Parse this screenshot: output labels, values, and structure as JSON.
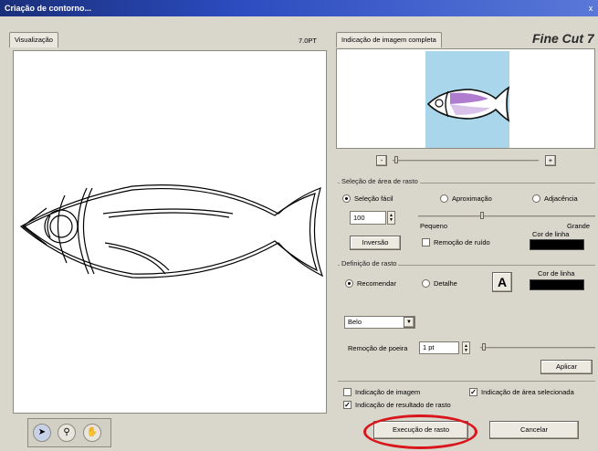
{
  "window": {
    "title": "Criação de contorno...",
    "close_glyph": "x"
  },
  "left_panel": {
    "tab_label": "Visualização",
    "thickness": "7.0PT"
  },
  "right_panel": {
    "tab_label": "Indicação de imagem completa",
    "logo": "Fine Cut 7",
    "zoom_minus": "-",
    "zoom_plus": "+"
  },
  "selection_group": {
    "title": "Seleção de área de rasto",
    "options": [
      "Seleção fácil",
      "Aproximação",
      "Adjacência"
    ],
    "selected_option": "Seleção fácil",
    "value": "100",
    "slider_min_label": "Pequeno",
    "slider_max_label": "Grande",
    "line_color_label": "Cor de linha",
    "line_color": "#000000",
    "inversion_button": "Inversão",
    "noise_removal_label": "Remoção de ruído",
    "noise_removal_checked": false
  },
  "definition_group": {
    "title": "Definição de rasto",
    "options": [
      "Recomendar",
      "Detalhe"
    ],
    "selected_option": "Recomendar",
    "line_color_label": "Cor de linha",
    "line_color": "#000000",
    "quality_select": "Belo",
    "dust_removal_label": "Remoção de poeira",
    "dust_removal_value": "1 pt",
    "apply_button": "Aplicar"
  },
  "display_options": [
    {
      "label": "Indicação de imagem",
      "checked": false
    },
    {
      "label": "Indicação de área selecionada",
      "checked": true
    },
    {
      "label": "Indicação de resultado de rasto",
      "checked": true
    }
  ],
  "actions": {
    "execute_button": "Execução de rasto",
    "cancel_button": "Cancelar"
  },
  "tools": [
    {
      "name": "pointer-tool",
      "active": true
    },
    {
      "name": "zoom-tool",
      "active": false
    },
    {
      "name": "hand-tool",
      "active": false
    }
  ],
  "colors": {
    "titlebar": "#2c4cc0",
    "highlight": "#d9161c",
    "fish_body": "#b07cd0",
    "preview_bg": "#a9d6ea"
  }
}
